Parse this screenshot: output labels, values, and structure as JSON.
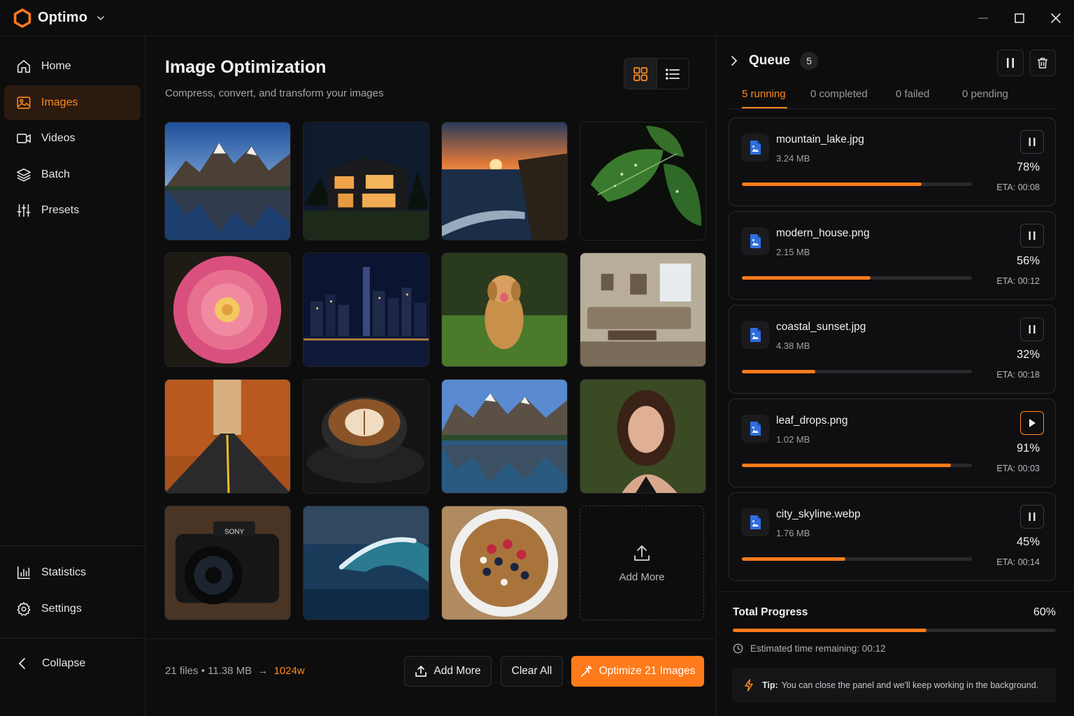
{
  "app": {
    "name": "Optimo",
    "accent": "#ff7a1a"
  },
  "window_controls": [
    {
      "name": "minimize-icon"
    },
    {
      "name": "maximize-icon"
    },
    {
      "name": "close-icon"
    }
  ],
  "sidebar": {
    "items": [
      {
        "label": "Home",
        "icon": "home-icon",
        "active": false
      },
      {
        "label": "Images",
        "icon": "image-icon",
        "active": true
      },
      {
        "label": "Videos",
        "icon": "video-icon",
        "active": false
      },
      {
        "label": "Batch",
        "icon": "layers-icon",
        "active": false
      },
      {
        "label": "Presets",
        "icon": "sliders-icon",
        "active": false
      }
    ],
    "bottom_items": [
      {
        "label": "Statistics",
        "icon": "bar-chart-icon"
      },
      {
        "label": "Settings",
        "icon": "gear-icon"
      }
    ],
    "collapse_label": "Collapse"
  },
  "main": {
    "title": "Image Optimization",
    "subtitle": "Compress, convert, and transform your images",
    "view_modes": [
      "grid",
      "list"
    ],
    "active_view": "grid",
    "thumbnails": [
      "mountain lake",
      "modern house",
      "coastal sunset",
      "leaf drops",
      "dahlia flower",
      "city skyline",
      "golden retriever",
      "living room",
      "autumn road",
      "latte art",
      "mountain lake reflection",
      "portrait",
      "camera",
      "ocean wave",
      "granola bowl"
    ],
    "add_tile_label": "Add More",
    "footer": {
      "files_summary": "21 files • 11.38 MB",
      "arrow": "→",
      "target": "1024w",
      "add_more_label": "Add More",
      "clear_all_label": "Clear All",
      "optimize_label": "Optimize 21 Images"
    }
  },
  "queue": {
    "title": "Queue",
    "count": "5",
    "tabs": [
      {
        "label": "5 running",
        "active": true
      },
      {
        "label": "0 completed",
        "active": false
      },
      {
        "label": "0 failed",
        "active": false
      },
      {
        "label": "0 pending",
        "active": false
      }
    ],
    "jobs": [
      {
        "name": "mountain_lake.jpg",
        "size": "3.24 MB",
        "percent_label": "78%",
        "progress": 0.78,
        "eta": "ETA: 00:08",
        "control": "pause"
      },
      {
        "name": "modern_house.png",
        "size": "2.15 MB",
        "percent_label": "56%",
        "progress": 0.56,
        "eta": "ETA: 00:12",
        "control": "pause"
      },
      {
        "name": "coastal_sunset.jpg",
        "size": "4.38 MB",
        "percent_label": "32%",
        "progress": 0.32,
        "eta": "ETA: 00:18",
        "control": "pause"
      },
      {
        "name": "leaf_drops.png",
        "size": "1.02 MB",
        "percent_label": "91%",
        "progress": 0.91,
        "eta": "ETA: 00:03",
        "control": "play"
      },
      {
        "name": "city_skyline.webp",
        "size": "1.76 MB",
        "percent_label": "45%",
        "progress": 0.45,
        "eta": "ETA: 00:14",
        "control": "pause"
      }
    ],
    "total": {
      "label": "Total Progress",
      "percent_label": "60%",
      "progress": 0.6,
      "eta_text": "Estimated time remaining: 00:12"
    },
    "tip": {
      "prefix": "Tip:",
      "text": "You can close the panel and we'll keep working in the background."
    }
  }
}
